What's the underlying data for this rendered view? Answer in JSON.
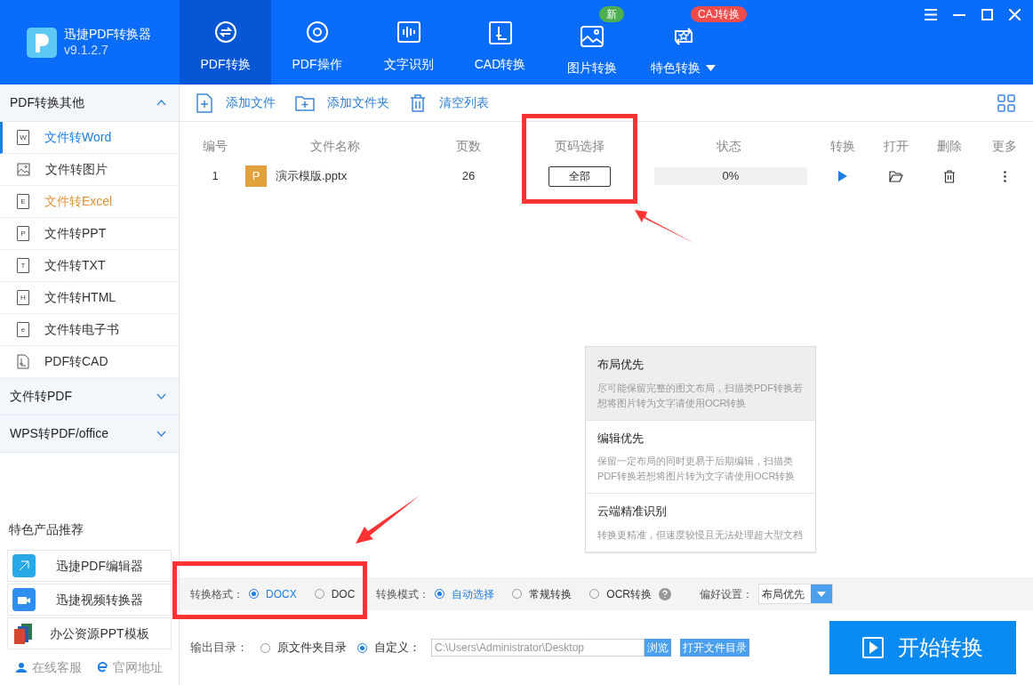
{
  "app": {
    "name": "迅捷PDF转换器",
    "version": "v9.1.2.7"
  },
  "nav_tabs": [
    {
      "label": "PDF转换",
      "kind": "convert",
      "selected": true
    },
    {
      "label": "PDF操作",
      "kind": "operate",
      "selected": false
    },
    {
      "label": "文字识别",
      "kind": "ocr",
      "selected": false
    },
    {
      "label": "CAD转换",
      "kind": "cad",
      "selected": false
    },
    {
      "label": "图片转换",
      "kind": "image",
      "selected": false,
      "badge": {
        "text": "新",
        "color": "#4cae4f"
      }
    },
    {
      "label": "特色转换",
      "kind": "feature",
      "selected": false,
      "dropdown": true,
      "badge": {
        "text": "CAJ转换",
        "color": "#f24b4b"
      }
    }
  ],
  "sidebar": {
    "sections": [
      {
        "title": "PDF转换其他",
        "expanded": true,
        "items": [
          {
            "label": "文件转Word",
            "kind": "letter",
            "letter": "W",
            "selected": true,
            "hovered": false
          },
          {
            "label": "文件转图片",
            "kind": "image",
            "selected": false,
            "hovered": false
          },
          {
            "label": "文件转Excel",
            "kind": "letter",
            "letter": "E",
            "selected": false,
            "hovered": true
          },
          {
            "label": "文件转PPT",
            "kind": "letter",
            "letter": "P",
            "selected": false,
            "hovered": false
          },
          {
            "label": "文件转TXT",
            "kind": "letter",
            "letter": "T",
            "selected": false,
            "hovered": false
          },
          {
            "label": "文件转HTML",
            "kind": "letter",
            "letter": "H",
            "selected": false,
            "hovered": false
          },
          {
            "label": "文件转电子书",
            "kind": "letter",
            "letter": "e",
            "selected": false,
            "hovered": false
          },
          {
            "label": "PDF转CAD",
            "kind": "cad",
            "selected": false,
            "hovered": false
          }
        ]
      },
      {
        "title": "文件转PDF",
        "expanded": false
      },
      {
        "title": "WPS转PDF/office",
        "expanded": false
      }
    ],
    "promo_title": "特色产品推荐",
    "promos": [
      {
        "label": "迅捷PDF编辑器",
        "kind": "editor"
      },
      {
        "label": "迅捷视频转换器",
        "kind": "video"
      },
      {
        "label": "办公资源PPT模板",
        "kind": "ppt"
      }
    ],
    "footer_links": [
      {
        "label": "在线客服",
        "kind": "support"
      },
      {
        "label": "官网地址",
        "kind": "web"
      }
    ]
  },
  "toolbar": [
    {
      "label": "添加文件",
      "kind": "add-file"
    },
    {
      "label": "添加文件夹",
      "kind": "add-folder"
    },
    {
      "label": "清空列表",
      "kind": "clear"
    }
  ],
  "table": {
    "columns": [
      "编号",
      "文件名称",
      "页数",
      "页码选择",
      "状态",
      "转换",
      "打开",
      "删除",
      "更多"
    ],
    "rows": [
      {
        "index": "1",
        "file_letter": "P",
        "file_name": "演示模版.pptx",
        "pages": "26",
        "page_range": "全部",
        "level": 0,
        "status": "0%"
      }
    ]
  },
  "preference_popup": {
    "options": [
      {
        "title": "布局优先",
        "description": "尽可能保留完整的图文布局，扫描类PDF转换若想将图片转为文字请使用OCR转换",
        "hovered": true
      },
      {
        "title": "编辑优先",
        "description": "保留一定布局的同时更易于后期编辑，扫描类PDF转换若想将图片转为文字请使用OCR转换",
        "hovered": false
      },
      {
        "title": "云端精准识别",
        "description": "转换更精准，但速度较慢且无法处理超大型文档",
        "hovered": false
      }
    ]
  },
  "options_bar": {
    "format_label": "转换格式：",
    "formats": [
      {
        "label": "DOCX",
        "selected": true
      },
      {
        "label": "DOC",
        "selected": false
      }
    ],
    "mode_label": "转换模式：",
    "modes": [
      {
        "label": "自动选择",
        "selected": true,
        "help": false
      },
      {
        "label": "常规转换",
        "selected": false,
        "help": false
      },
      {
        "label": "OCR转换",
        "selected": false,
        "help": true
      }
    ],
    "preference_label": "偏好设置：",
    "preference_value": "布局优先"
  },
  "output": {
    "label": "输出目录：",
    "choices": [
      {
        "label": "原文件夹目录",
        "selected": false
      },
      {
        "label": "自定义：",
        "selected": true
      }
    ],
    "path": "C:\\Users\\Administrator\\Desktop",
    "browse": "浏览",
    "open_dir": "打开文件目录"
  },
  "start_button": "开始转换"
}
